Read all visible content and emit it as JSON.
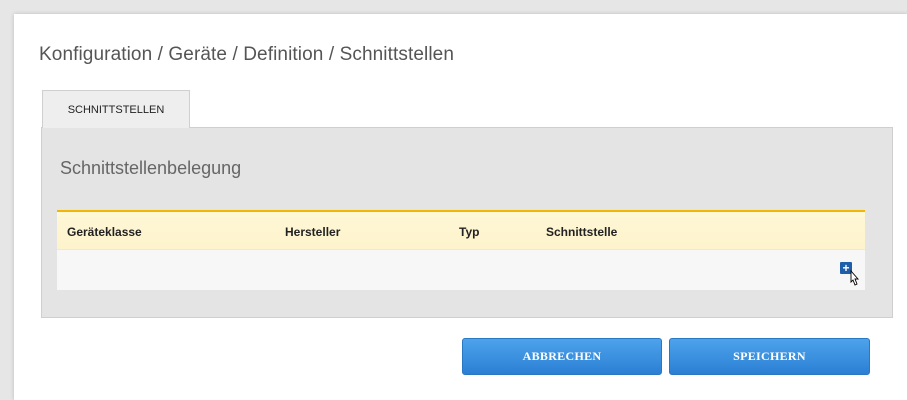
{
  "breadcrumb": "Konfiguration / Geräte / Definition / Schnittstellen",
  "tab": {
    "label": "SCHNITTSTELLEN"
  },
  "section": {
    "title": "Schnittstellenbelegung"
  },
  "table": {
    "columns": [
      "Geräteklasse",
      "Hersteller",
      "Typ",
      "Schnittstelle"
    ],
    "add_icon": "plus-icon"
  },
  "buttons": {
    "cancel": "ABBRECHEN",
    "save": "SPEICHERN"
  },
  "colors": {
    "accent_yellow": "#f2b705",
    "button_blue": "#2a7fd4",
    "add_blue": "#1f5ea8"
  }
}
